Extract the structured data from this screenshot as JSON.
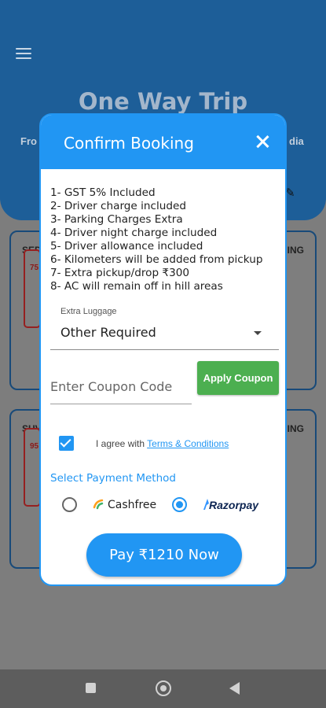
{
  "background": {
    "title": "One Way Trip",
    "from_fragment": "Fro",
    "to_fragment": "dia",
    "cards": [
      {
        "left_label": "SED",
        "right_label": "ING",
        "thumb_text": "75"
      },
      {
        "left_label": "SUV",
        "right_label": "ING",
        "thumb_text": "95"
      }
    ]
  },
  "dialog": {
    "title": "Confirm Booking",
    "terms": [
      "1- GST 5% Included",
      "2- Driver charge included",
      "3- Parking Charges Extra",
      "4- Driver night charge included",
      "5- Driver allowance included",
      "6- Kilometers will be added from pickup",
      "7- Extra pickup/drop ₹300",
      "8- AC will remain off in hill areas"
    ],
    "luggage": {
      "label": "Extra Luggage",
      "value": "Other Required"
    },
    "coupon": {
      "placeholder": "Enter Coupon Code",
      "value": "",
      "apply_label": "Apply Coupon"
    },
    "agree": {
      "checked": true,
      "text": "I agree with ",
      "link": "Terms & Conditions"
    },
    "payment": {
      "label": "Select Payment Method",
      "options": [
        {
          "name": "Cashfree",
          "selected": false
        },
        {
          "name": "Razorpay",
          "selected": true
        }
      ]
    },
    "pay_button": "Pay ₹1210 Now"
  },
  "colors": {
    "primary": "#2196f3",
    "apply": "#4caf50",
    "header_bg": "#1d5e98"
  }
}
